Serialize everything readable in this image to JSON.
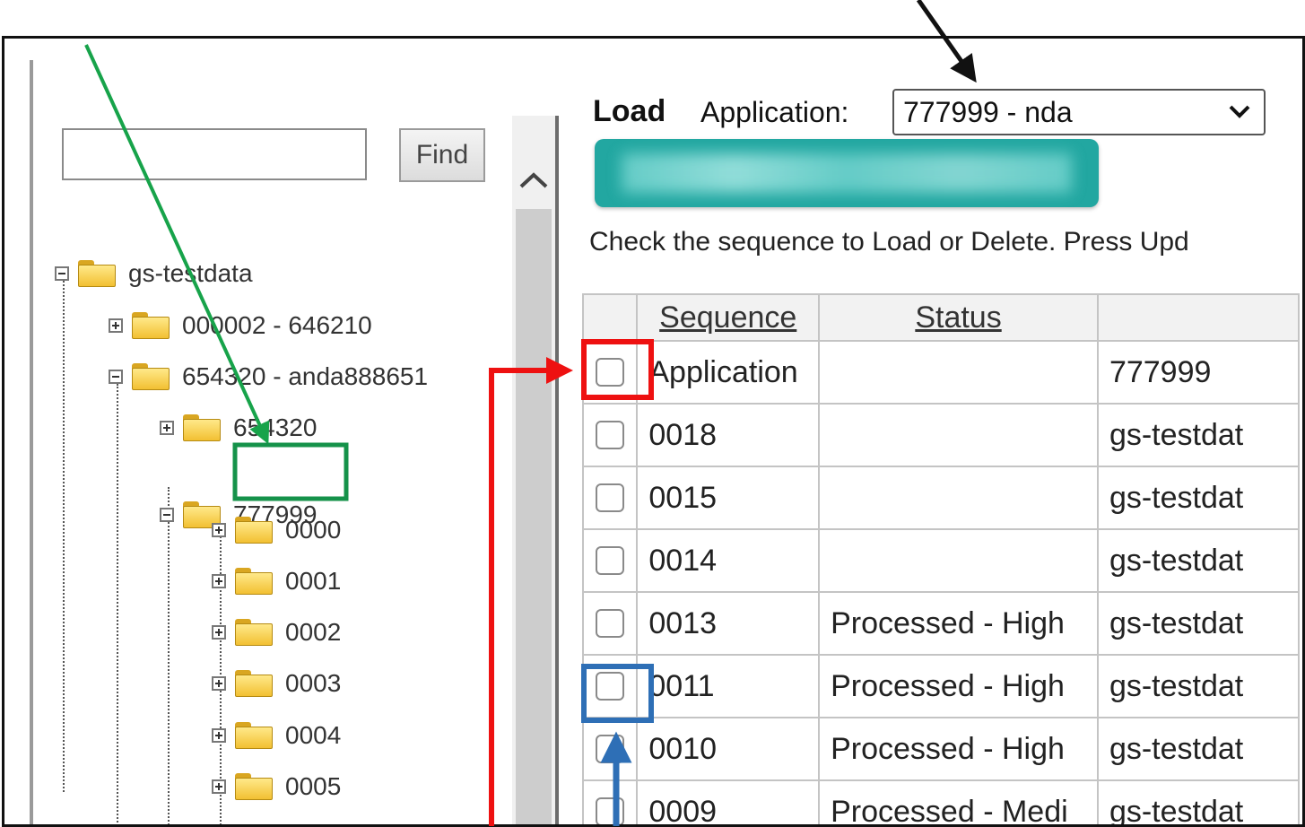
{
  "sidebar": {
    "find_button": "Find",
    "find_input_value": "",
    "tree": [
      {
        "label": "gs-testdata",
        "expanded": true
      },
      {
        "label": "000002 - 646210",
        "expanded": false
      },
      {
        "label": "654320 - anda888651",
        "expanded": true
      },
      {
        "label": "654320",
        "expanded": false
      },
      {
        "label": "777999",
        "expanded": true
      },
      {
        "label": "0000",
        "expanded": false
      },
      {
        "label": "0001",
        "expanded": false
      },
      {
        "label": "0002",
        "expanded": false
      },
      {
        "label": "0003",
        "expanded": false
      },
      {
        "label": "0004",
        "expanded": false
      },
      {
        "label": "0005",
        "expanded": false
      }
    ]
  },
  "main": {
    "title": "Load",
    "application_label": "Application:",
    "application_value": "777999 - nda",
    "instruction": "Check the sequence to Load or Delete. Press Upd",
    "columns": [
      "Sequence",
      "Status"
    ],
    "rows": [
      {
        "sequence": "Application",
        "status": "",
        "source": "777999"
      },
      {
        "sequence": "0018",
        "status": "",
        "source": "gs-testdat"
      },
      {
        "sequence": "0015",
        "status": "",
        "source": "gs-testdat"
      },
      {
        "sequence": "0014",
        "status": "",
        "source": "gs-testdat"
      },
      {
        "sequence": "0013",
        "status": "Processed - High",
        "source": "gs-testdat"
      },
      {
        "sequence": "0011",
        "status": "Processed - High",
        "source": "gs-testdat"
      },
      {
        "sequence": "0010",
        "status": "Processed - High",
        "source": "gs-testdat"
      },
      {
        "sequence": "0009",
        "status": "Processed - Medi",
        "source": "gs-testdat"
      }
    ]
  },
  "annotations": {
    "arrow_black": "#111111",
    "arrow_green": "#17a34a",
    "box_green": "#15924a",
    "box_red": "#ee1111",
    "box_blue": "#2e6fb6"
  }
}
